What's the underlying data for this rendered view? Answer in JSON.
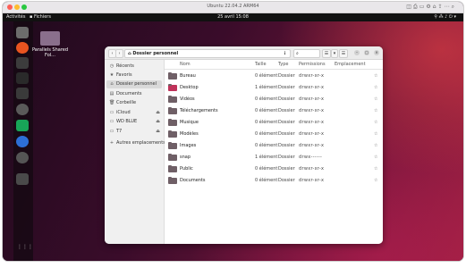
{
  "host": {
    "title": "Ubuntu 22.04.2 ARM64",
    "traffic_colors": [
      "#fe5f57",
      "#febc2e",
      "#28c840"
    ],
    "tool_icons": [
      "◫",
      "⎙",
      "▭",
      "⚙",
      "⌂",
      "⇪",
      "⋯",
      "⌕"
    ]
  },
  "topbar": {
    "activities": "Activités",
    "app_name": "Fichiers",
    "clock": "25 avril  15:08",
    "status_icons": "⚲  ⁂  ♪  ⏻ ▾"
  },
  "desktop": {
    "folder_label": "Parallels Shared Fol..."
  },
  "dock": {
    "colors": [
      "#6c6c6c",
      "#e95420",
      "#3c3c3c",
      "#2a2a2a",
      "#3a3a3a",
      "#5a5a5a",
      "#18a558",
      "#2d6fd6",
      "#555555",
      "#4a4a4a"
    ],
    "apps_grid_icon": "⋮⋮⋮"
  },
  "filemanager": {
    "path_label": "Dossier personnel",
    "path_icon": "⌂",
    "menu_icon": "⋮",
    "search_icon": "⌕",
    "view_icon": "☰",
    "sort_icon": "▾",
    "window_minimize": "–",
    "window_maximize": "□",
    "window_close": "×",
    "sidebar": [
      {
        "icon": "◷",
        "label": "Récents",
        "eject": ""
      },
      {
        "icon": "★",
        "label": "Favoris",
        "eject": ""
      },
      {
        "icon": "⌂",
        "label": "Dossier personnel",
        "eject": ""
      },
      {
        "icon": "▤",
        "label": "Documents",
        "eject": ""
      },
      {
        "icon": "🗑",
        "label": "Corbeille",
        "eject": ""
      },
      {
        "icon": "▭",
        "label": "iCloud",
        "eject": "⏏"
      },
      {
        "icon": "▭",
        "label": "WD BLUE",
        "eject": "⏏"
      },
      {
        "icon": "▭",
        "label": "T7",
        "eject": "⏏"
      },
      {
        "icon": "+",
        "label": "Autres emplacements",
        "eject": ""
      }
    ],
    "columns": {
      "name": "Nom",
      "size": "Taille",
      "type": "Type",
      "permissions": "Permissions",
      "location": "Emplacement"
    },
    "rows": [
      {
        "name": "Bureau",
        "size": "0 élément",
        "type": "Dossier",
        "perm": "drwxr-xr-x",
        "icon_color": "#6f5f66",
        "star": "☆"
      },
      {
        "name": "Desktop",
        "size": "1 élément",
        "type": "Dossier",
        "perm": "drwxr-xr-x",
        "icon_color": "#c0325a",
        "star": "☆"
      },
      {
        "name": "Vidéos",
        "size": "0 élément",
        "type": "Dossier",
        "perm": "drwxr-xr-x",
        "icon_color": "#6f5f66",
        "star": "☆"
      },
      {
        "name": "Téléchargements",
        "size": "0 élément",
        "type": "Dossier",
        "perm": "drwxr-xr-x",
        "icon_color": "#6f5f66",
        "star": "☆"
      },
      {
        "name": "Musique",
        "size": "0 élément",
        "type": "Dossier",
        "perm": "drwxr-xr-x",
        "icon_color": "#6f5f66",
        "star": "☆"
      },
      {
        "name": "Modèles",
        "size": "0 élément",
        "type": "Dossier",
        "perm": "drwxr-xr-x",
        "icon_color": "#6f5f66",
        "star": "☆"
      },
      {
        "name": "Images",
        "size": "0 élément",
        "type": "Dossier",
        "perm": "drwxr-xr-x",
        "icon_color": "#6f5f66",
        "star": "☆"
      },
      {
        "name": "snap",
        "size": "1 élément",
        "type": "Dossier",
        "perm": "drwx------",
        "icon_color": "#6f5f66",
        "star": "☆"
      },
      {
        "name": "Public",
        "size": "0 élément",
        "type": "Dossier",
        "perm": "drwxr-xr-x",
        "icon_color": "#6f5f66",
        "star": "☆"
      },
      {
        "name": "Documents",
        "size": "0 élément",
        "type": "Dossier",
        "perm": "drwxr-xr-x",
        "icon_color": "#6f5f66",
        "star": "☆"
      }
    ]
  }
}
